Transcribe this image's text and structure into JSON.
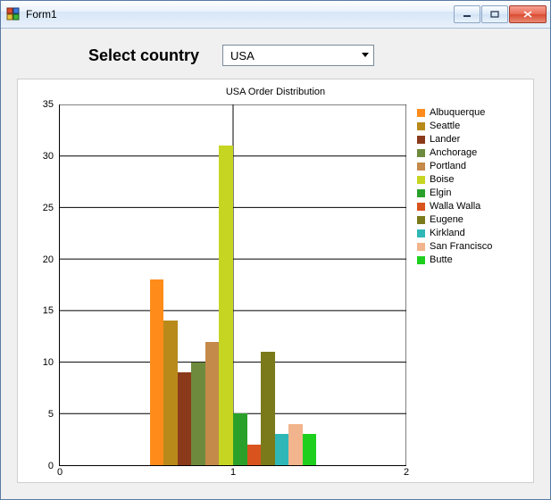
{
  "window": {
    "title": "Form1"
  },
  "controls": {
    "label": "Select country",
    "country_select": {
      "value": "USA"
    }
  },
  "chart_data": {
    "type": "bar",
    "title": "USA Order Distribution",
    "xlabel": "",
    "ylabel": "",
    "xlim": [
      0,
      2
    ],
    "ylim": [
      0,
      35
    ],
    "x_ticks": [
      0,
      1,
      2
    ],
    "y_ticks": [
      0,
      5,
      10,
      15,
      20,
      25,
      30,
      35
    ],
    "categories": [
      "1"
    ],
    "series": [
      {
        "name": "Albuquerque",
        "values": [
          18
        ],
        "color": "#ff8c1a"
      },
      {
        "name": "Seattle",
        "values": [
          14
        ],
        "color": "#b88a1a"
      },
      {
        "name": "Lander",
        "values": [
          9
        ],
        "color": "#8a3a1a"
      },
      {
        "name": "Anchorage",
        "values": [
          10
        ],
        "color": "#6e8b3d"
      },
      {
        "name": "Portland",
        "values": [
          12
        ],
        "color": "#c48a4a"
      },
      {
        "name": "Boise",
        "values": [
          31
        ],
        "color": "#c6d521"
      },
      {
        "name": "Elgin",
        "values": [
          5
        ],
        "color": "#2aa02a"
      },
      {
        "name": "Walla Walla",
        "values": [
          2
        ],
        "color": "#d9531e"
      },
      {
        "name": "Eugene",
        "values": [
          11
        ],
        "color": "#7a7a1a"
      },
      {
        "name": "Kirkland",
        "values": [
          3
        ],
        "color": "#2fb7b7"
      },
      {
        "name": "San Francisco",
        "values": [
          4
        ],
        "color": "#f2b48c"
      },
      {
        "name": "Butte",
        "values": [
          3
        ],
        "color": "#1ecf1e"
      }
    ]
  }
}
